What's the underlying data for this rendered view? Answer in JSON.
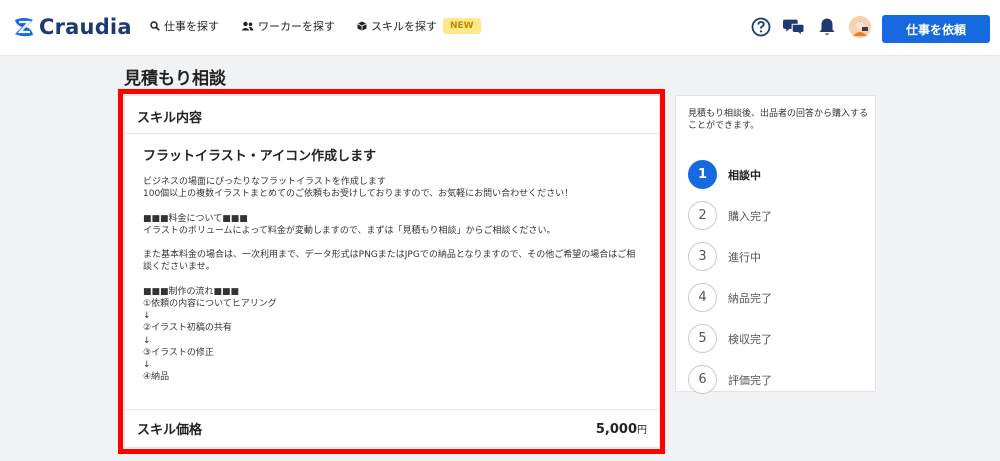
{
  "header": {
    "logo_text": "Craudia",
    "nav": [
      {
        "label": "仕事を探す",
        "icon": "search-icon"
      },
      {
        "label": "ワーカーを探す",
        "icon": "users-icon"
      },
      {
        "label": "スキルを探す",
        "icon": "box-icon",
        "badge": "NEW"
      }
    ],
    "icons": [
      "help-icon",
      "chat-icon",
      "bell-icon"
    ],
    "cta_label": "仕事を依頼"
  },
  "page": {
    "title": "見積もり相談"
  },
  "card": {
    "header": "スキル内容",
    "skill_title": "フラットイラスト・アイコン作成します",
    "description": "ビジネスの場面にぴったりなフラットイラストを作成します\n100個以上の複数イラストまとめてのご依頼もお受けしておりますので、お気軽にお問い合わせください！\n\n■■■料金について■■■\nイラストのボリュームによって料金が変動しますので、まずは「見積もり相談」からご相談ください。\n\nまた基本料金の場合は、一次利用まで、データ形式はPNGまたはJPGでの納品となりますので、その他ご希望の場合はご相談くださいませ。\n\n■■■制作の流れ■■■\n①依頼の内容についてヒアリング\n↓\n②イラスト初稿の共有\n↓\n③イラストの修正\n↓\n④納品",
    "price_label": "スキル価格",
    "price_value": "5,000",
    "price_unit": "円"
  },
  "side": {
    "note": "見積もり相談後、出品者の回答から購入することができます。",
    "steps": [
      {
        "num": "1",
        "label": "相談中",
        "active": true
      },
      {
        "num": "2",
        "label": "購入完了"
      },
      {
        "num": "3",
        "label": "進行中"
      },
      {
        "num": "4",
        "label": "納品完了"
      },
      {
        "num": "5",
        "label": "検収完了"
      },
      {
        "num": "6",
        "label": "評価完了"
      }
    ]
  },
  "colors": {
    "accent": "#1769e0",
    "highlight": "#ff0000",
    "badge_bg": "#fde98a"
  }
}
